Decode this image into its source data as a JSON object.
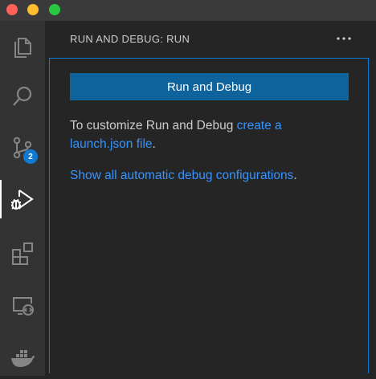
{
  "window": {
    "traffic_lights": [
      "close",
      "minimize",
      "maximize"
    ]
  },
  "activity_bar": {
    "items": [
      {
        "icon": "explorer-icon"
      },
      {
        "icon": "search-icon"
      },
      {
        "icon": "source-control-icon",
        "badge": "2"
      },
      {
        "icon": "run-debug-icon"
      },
      {
        "icon": "extensions-icon"
      },
      {
        "icon": "remote-explorer-icon"
      },
      {
        "icon": "docker-icon"
      }
    ]
  },
  "sidebar": {
    "title": "RUN AND DEBUG: RUN",
    "more_icon": "more-actions-icon",
    "run_button_label": "Run and Debug",
    "customize_text": "To customize Run and Debug ",
    "create_link": "create a launch.json file",
    "period_1": ".",
    "show_all_link": "Show all automatic debug configurations",
    "period_2": "."
  },
  "colors": {
    "accent": "#0e639c",
    "link": "#3794ff",
    "badge": "#0e7ad3",
    "focus_border": "#0d7ad6"
  }
}
